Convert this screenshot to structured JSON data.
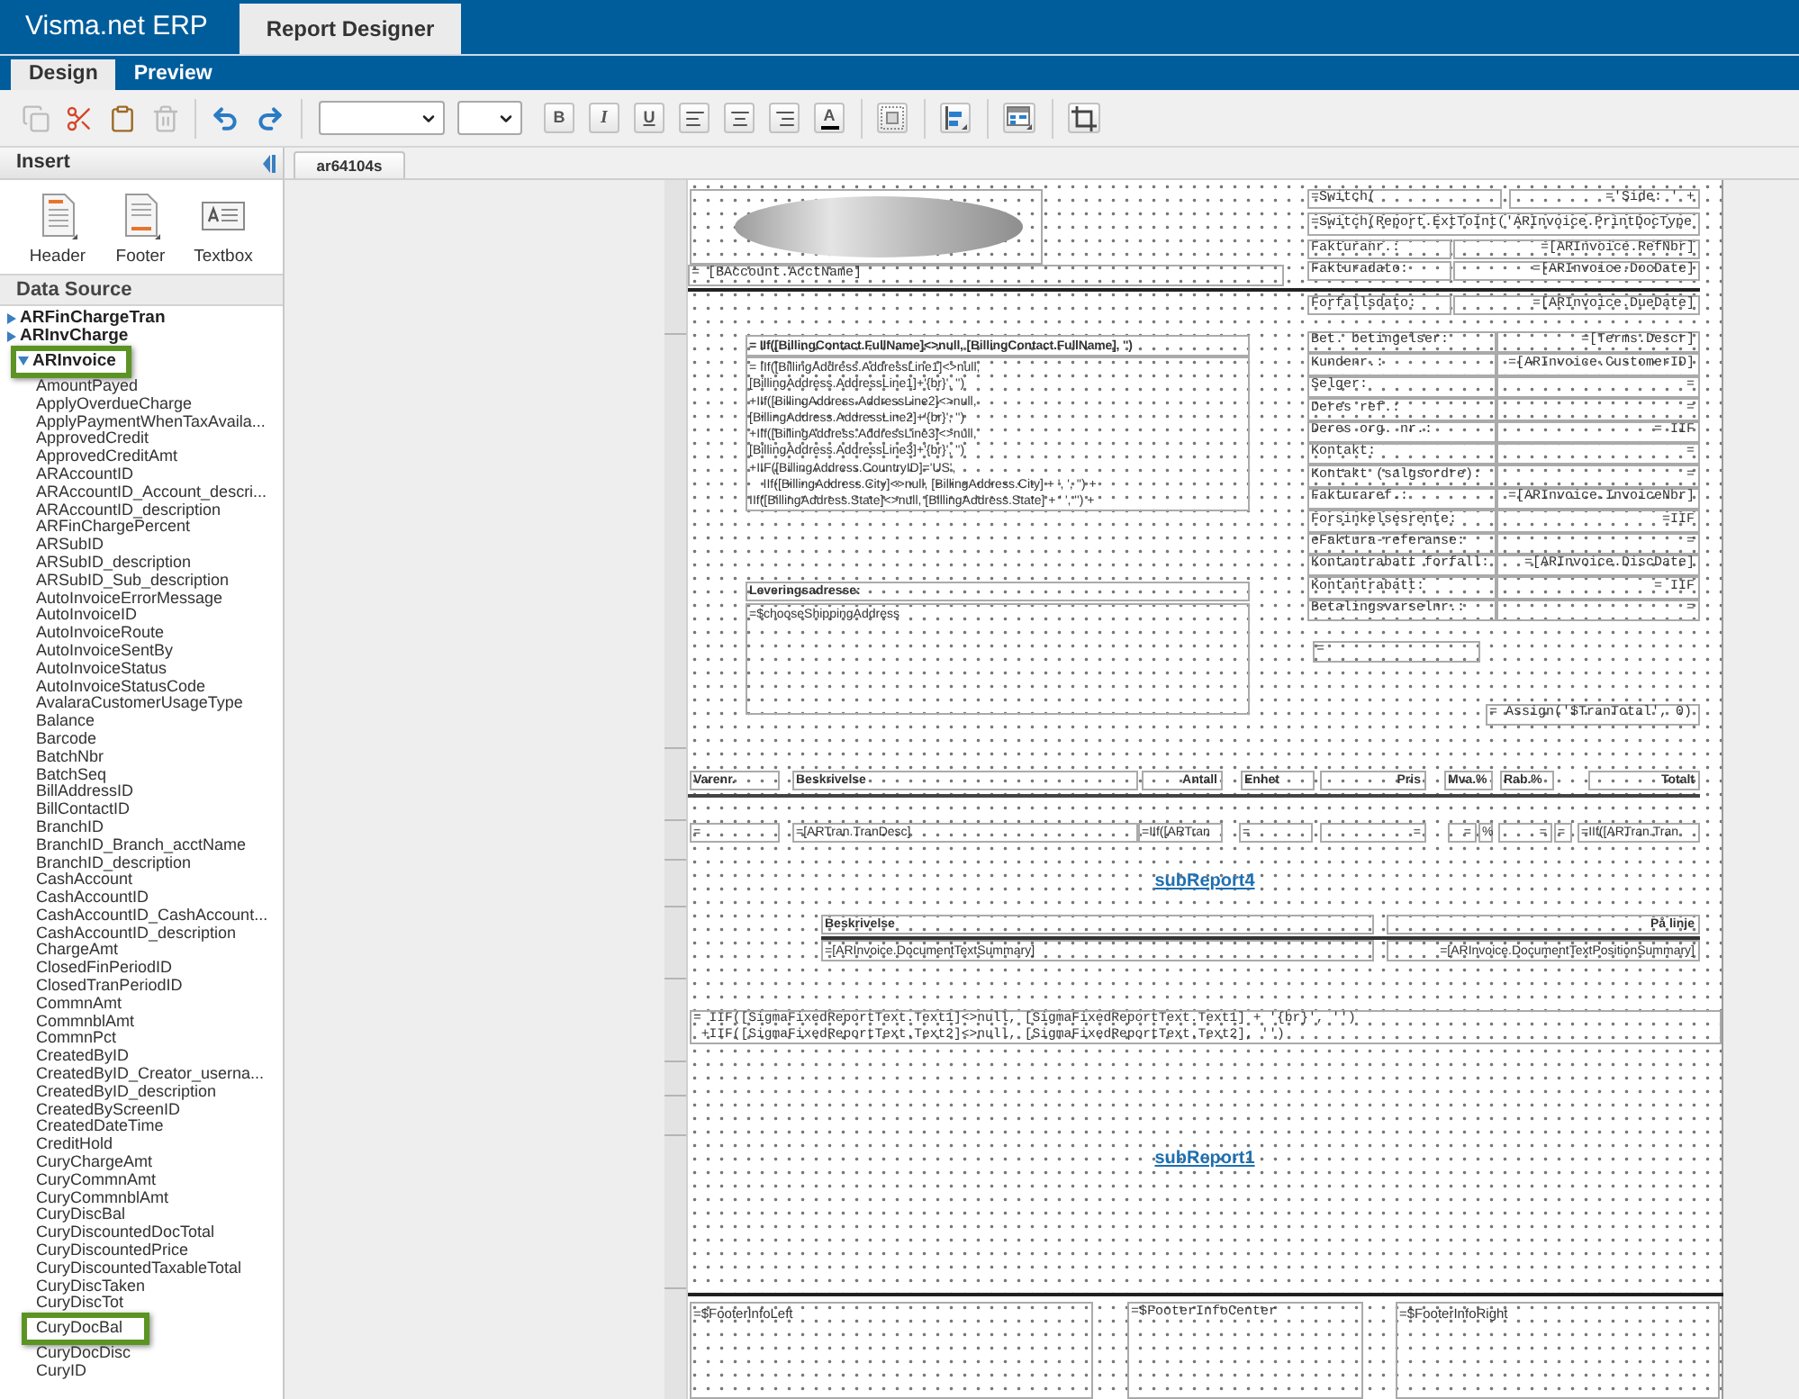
{
  "app": {
    "title": "Visma.net ERP",
    "tabs": [
      {
        "label": "Report Designer",
        "selected": true
      }
    ]
  },
  "mode_tabs": [
    {
      "label": "Design",
      "selected": true
    },
    {
      "label": "Preview",
      "selected": false
    }
  ],
  "toolbar": {
    "edit": [
      {
        "kind": "copy",
        "disabled": true
      },
      {
        "kind": "cut",
        "disabled": false
      },
      {
        "kind": "paste",
        "disabled": false
      },
      {
        "kind": "delete",
        "disabled": true
      }
    ],
    "history": [
      {
        "kind": "undo"
      },
      {
        "kind": "redo"
      }
    ],
    "format": [
      {
        "kind": "bold",
        "label": "B"
      },
      {
        "kind": "italic",
        "label": "I"
      },
      {
        "kind": "underline",
        "label": "U"
      },
      {
        "kind": "align_left"
      },
      {
        "kind": "align_center"
      },
      {
        "kind": "align_right"
      },
      {
        "kind": "font_color",
        "label": "A"
      }
    ],
    "arrange": [
      {
        "kind": "snap_grid"
      },
      {
        "kind": "align"
      },
      {
        "kind": "table"
      },
      {
        "kind": "resize"
      }
    ]
  },
  "insert_panel": {
    "title": "Insert",
    "items": [
      {
        "kind": "header",
        "label": "Header"
      },
      {
        "kind": "footer",
        "label": "Footer"
      },
      {
        "kind": "textbox",
        "label": "Textbox"
      }
    ]
  },
  "data_source": {
    "title": "Data Source",
    "tree": [
      {
        "label": "ARFinChargeTran",
        "expanded": false,
        "highlighted": false
      },
      {
        "label": "ARInvCharge",
        "expanded": false,
        "highlighted": false
      },
      {
        "label": "ARInvoice",
        "expanded": true,
        "highlighted": true,
        "children": [
          {
            "label": "AmountPayed",
            "highlighted": false
          },
          {
            "label": "ApplyOverdueCharge",
            "highlighted": false
          },
          {
            "label": "ApplyPaymentWhenTaxAvaila...",
            "highlighted": false
          },
          {
            "label": "ApprovedCredit",
            "highlighted": false
          },
          {
            "label": "ApprovedCreditAmt",
            "highlighted": false
          },
          {
            "label": "ARAccountID",
            "highlighted": false
          },
          {
            "label": "ARAccountID_Account_descri...",
            "highlighted": false
          },
          {
            "label": "ARAccountID_description",
            "highlighted": false
          },
          {
            "label": "ARFinChargePercent",
            "highlighted": false
          },
          {
            "label": "ARSubID",
            "highlighted": false
          },
          {
            "label": "ARSubID_description",
            "highlighted": false
          },
          {
            "label": "ARSubID_Sub_description",
            "highlighted": false
          },
          {
            "label": "AutoInvoiceErrorMessage",
            "highlighted": false
          },
          {
            "label": "AutoInvoiceID",
            "highlighted": false
          },
          {
            "label": "AutoInvoiceRoute",
            "highlighted": false
          },
          {
            "label": "AutoInvoiceSentBy",
            "highlighted": false
          },
          {
            "label": "AutoInvoiceStatus",
            "highlighted": false
          },
          {
            "label": "AutoInvoiceStatusCode",
            "highlighted": false
          },
          {
            "label": "AvalaraCustomerUsageType",
            "highlighted": false
          },
          {
            "label": "Balance",
            "highlighted": false
          },
          {
            "label": "Barcode",
            "highlighted": false
          },
          {
            "label": "BatchNbr",
            "highlighted": false
          },
          {
            "label": "BatchSeq",
            "highlighted": false
          },
          {
            "label": "BillAddressID",
            "highlighted": false
          },
          {
            "label": "BillContactID",
            "highlighted": false
          },
          {
            "label": "BranchID",
            "highlighted": false
          },
          {
            "label": "BranchID_Branch_acctName",
            "highlighted": false
          },
          {
            "label": "BranchID_description",
            "highlighted": false
          },
          {
            "label": "CashAccount",
            "highlighted": false
          },
          {
            "label": "CashAccountID",
            "highlighted": false
          },
          {
            "label": "CashAccountID_CashAccount...",
            "highlighted": false
          },
          {
            "label": "CashAccountID_description",
            "highlighted": false
          },
          {
            "label": "ChargeAmt",
            "highlighted": false
          },
          {
            "label": "ClosedFinPeriodID",
            "highlighted": false
          },
          {
            "label": "ClosedTranPeriodID",
            "highlighted": false
          },
          {
            "label": "CommnAmt",
            "highlighted": false
          },
          {
            "label": "CommnblAmt",
            "highlighted": false
          },
          {
            "label": "CommnPct",
            "highlighted": false
          },
          {
            "label": "CreatedByID",
            "highlighted": false
          },
          {
            "label": "CreatedByID_Creator_userna...",
            "highlighted": false
          },
          {
            "label": "CreatedByID_description",
            "highlighted": false
          },
          {
            "label": "CreatedByScreenID",
            "highlighted": false
          },
          {
            "label": "CreatedDateTime",
            "highlighted": false
          },
          {
            "label": "CreditHold",
            "highlighted": false
          },
          {
            "label": "CuryChargeAmt",
            "highlighted": false
          },
          {
            "label": "CuryCommnAmt",
            "highlighted": false
          },
          {
            "label": "CuryCommnblAmt",
            "highlighted": false
          },
          {
            "label": "CuryDiscBal",
            "highlighted": false
          },
          {
            "label": "CuryDiscountedDocTotal",
            "highlighted": false
          },
          {
            "label": "CuryDiscountedPrice",
            "highlighted": false
          },
          {
            "label": "CuryDiscountedTaxableTotal",
            "highlighted": false
          },
          {
            "label": "CuryDiscTaken",
            "highlighted": false
          },
          {
            "label": "CuryDiscTot",
            "highlighted": false
          },
          {
            "label": "CuryDocBal",
            "highlighted": true
          },
          {
            "label": "CuryDocDisc",
            "highlighted": false
          },
          {
            "label": "CuryID",
            "highlighted": false
          }
        ]
      }
    ]
  },
  "document_tabs": [
    {
      "label": "ar64104s",
      "selected": true
    }
  ],
  "report": {
    "page_header": {
      "account_name": "= [BAccount.AcctName]",
      "page_switch": "=Switch(",
      "page_label": "='Side: ' +",
      "doc_type": "=Switch(Report.ExtToInt('ARInvoice.PrintDocType",
      "fields": [
        {
          "label": "Fakturanr.:",
          "value": "=[ARInvoice.RefNbr]"
        },
        {
          "label": "Fakturadato:",
          "value": "=[ARInvoice.DocDate]"
        }
      ]
    },
    "due_date": {
      "label": "Forfallsdato:",
      "value": "=[ARInvoice.DueDate]"
    },
    "billing": {
      "name": "= IIf([BillingContact.FullName]<>null, [BillingContact.FullName], '')",
      "address": [
        "= IIf([BillingAddress.AddressLine1]<>null,",
        "[BillingAddress.AddressLine1]+'{br}', '')",
        "+IIf([BillingAddress.AddressLine2]<>null,",
        "[BillingAddress.AddressLine2]+'{br}', '')",
        "+IIf([BillingAddress.AddressLine3]<>null,",
        "[BillingAddress.AddressLine3]+'{br}', '')",
        "+IIF([BillingAddress.CountryID]='US',",
        "    IIf([BillingAddress.City]<>null, [BillingAddress.City] + ', ', '') +",
        "IIf([BillingAddress.State]<>null, [BillingAddress.State] + ' ', '') +"
      ]
    },
    "shipping": {
      "title": "Leveringsadresse:",
      "value": "=$chooseShippingAddress"
    },
    "details": [
      {
        "label": "Bet. betingelser:",
        "value": "=[Terms.Descr]"
      },
      {
        "label": "Kundenr.:",
        "value": "=[ARInvoice.CustomerID]"
      },
      {
        "label": "Selger:",
        "value": "="
      },
      {
        "label": "Deres ref.:",
        "value": "="
      },
      {
        "label": "Deres org. nr.:",
        "value": "= IIF"
      },
      {
        "label": "Kontakt:",
        "value": "="
      },
      {
        "label": "Kontakt (salgsordre):",
        "value": "="
      },
      {
        "label": "Fakturaref.:",
        "value": "=[ARInvoice.InvoiceNbr]"
      },
      {
        "label": "Forsinkelsesrente:",
        "value": "=IIF"
      },
      {
        "label": "eFaktura-referanse:",
        "value": "="
      },
      {
        "label": "Kontantrabatt forfall:",
        "value": "=[ARInvoice.DiscDate]"
      },
      {
        "label": "Kontantrabatt:",
        "value": "= IIF"
      },
      {
        "label": "Betalingsvarselnr.:",
        "value": "="
      }
    ],
    "blank_field": "=",
    "assign": "= Assign('$TranTotal', 0)",
    "columns": [
      "Varenr.",
      "Beskrivelse",
      "Antall",
      "Enhet",
      "Pris",
      "Mva.%",
      "Rab.%",
      "Totalt"
    ],
    "line_fields": [
      "=",
      "=[ARTran.TranDesc]",
      "=IIf([ARTran",
      "=",
      "=",
      "=",
      "%",
      "=",
      "=",
      "=IIf([ARTran.Tran"
    ],
    "first_subreport": "subReport4",
    "document_text": {
      "columns": [
        "Beskrivelse",
        "På linje"
      ],
      "values": [
        "=[ARInvoice.DocumentTextSummary]",
        "=[ARInvoice.DocumentTextPositionSummary]"
      ]
    },
    "fixed_text": [
      "= IIF([SigmaFixedReportText.Text1]<>null, [SigmaFixedReportText.Text1] + '{br}', '')",
      " +IIF([SigmaFixedReportText.Text2]<>null, [SigmaFixedReportText.Text2], '')"
    ],
    "second_subreport": "subReport1",
    "footer": [
      "=$FooterInfoLeft",
      "=$FooterInfoCenter",
      "=$FooterInfoRight"
    ]
  }
}
